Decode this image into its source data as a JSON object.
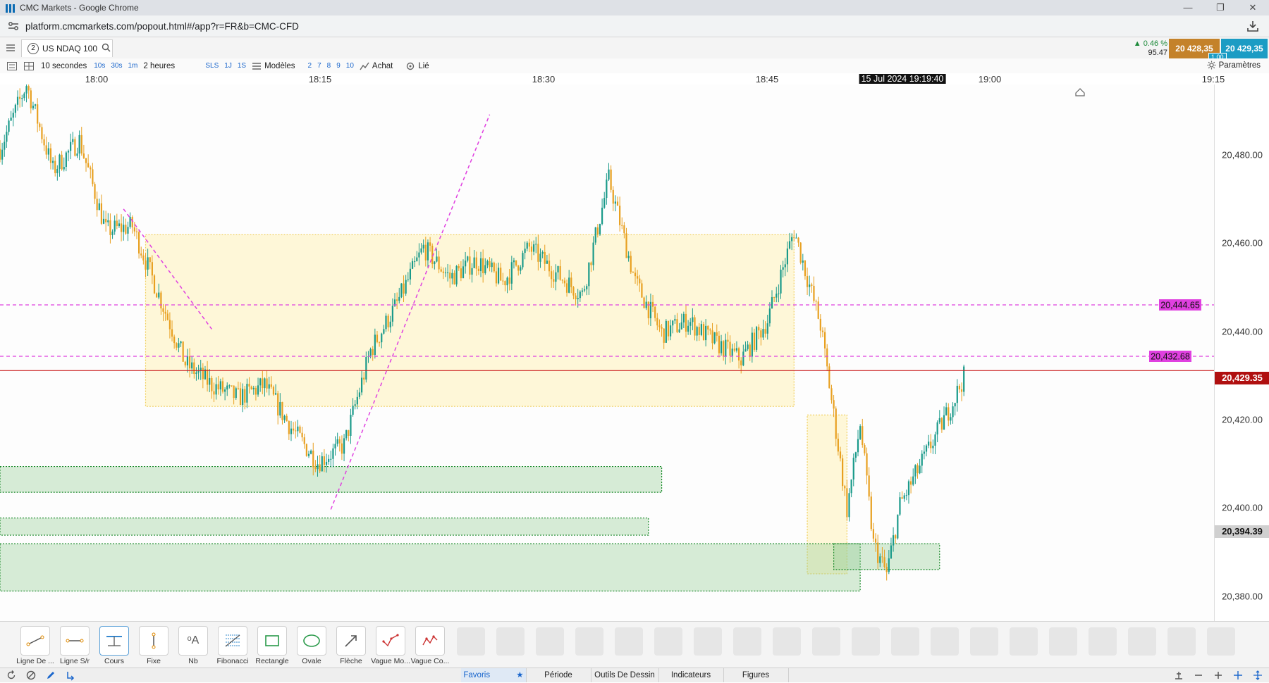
{
  "browser": {
    "window_title": "CMC Markets - Google Chrome",
    "url": "platform.cmcmarkets.com/popout.html#/app?r=FR&b=CMC-CFD"
  },
  "instrument": {
    "tab_number": "2",
    "name": "US NDAQ 100",
    "change_percent": "▲ 0.46 %",
    "change_points": "95.47",
    "sell_price": "20 428,35",
    "buy_price": "20 429,35",
    "spread": "1.00"
  },
  "toolbar": {
    "interval": "10 secondes",
    "quick_intervals": [
      "10s",
      "30s",
      "1m"
    ],
    "range": "2 heures",
    "quick_ranges": [
      "SLS",
      "1J",
      "1S"
    ],
    "templates": "Modèles",
    "template_slots": [
      "2",
      "7",
      "8",
      "9",
      "10"
    ],
    "buy_label": "Achat",
    "linked_label": "Lié",
    "settings_label": "Paramètres"
  },
  "time_axis": {
    "labels": [
      "18:00",
      "18:15",
      "18:30",
      "18:45",
      "19:00",
      "19:15"
    ],
    "cursor_label": "15 Jul 2024 19:19:40"
  },
  "price_axis": {
    "labels": [
      "20,480.00",
      "20,460.00",
      "20,440.00",
      "20,420.00",
      "20,400.00",
      "20,380.00"
    ],
    "current_price": "20,429.35",
    "hover_price": "20,394.39"
  },
  "chart_data": {
    "type": "candlestick",
    "instrument": "US NDAQ 100",
    "interval": "10 secondes",
    "y_range": [
      20371,
      20496
    ],
    "x_range": [
      "17:58",
      "19:19:40"
    ],
    "current_price": 20429.35,
    "horizontal_lines": [
      {
        "price": 20444.65,
        "label": "20,444.65",
        "color": "#e040e0",
        "style": "dashed"
      },
      {
        "price": 20432.68,
        "label": "20,432.68",
        "color": "#e040e0",
        "style": "dashed"
      },
      {
        "price": 20429.35,
        "color": "#cc2020",
        "style": "solid"
      }
    ],
    "trend_lines": [
      {
        "from": [
          "18:07:20",
          20467
        ],
        "to": [
          "18:14",
          20439
        ],
        "color": "#e040e0"
      },
      {
        "from": [
          "18:23",
          20397
        ],
        "to": [
          "18:35",
          20489
        ],
        "color": "#e040e0"
      }
    ],
    "rectangles": [
      {
        "from": [
          "18:09",
          20461
        ],
        "to": [
          "18:58",
          20421
        ],
        "fill": "yellow"
      },
      {
        "from": [
          "18:59",
          20419
        ],
        "to": [
          "19:02",
          20382
        ],
        "fill": "yellow"
      },
      {
        "from": [
          "17:58",
          20407
        ],
        "to": [
          "18:48",
          20401
        ],
        "fill": "green"
      },
      {
        "from": [
          "17:58",
          20395
        ],
        "to": [
          "18:47",
          20391
        ],
        "fill": "green"
      },
      {
        "from": [
          "17:58",
          20389
        ],
        "to": [
          "19:03",
          20378
        ],
        "fill": "green"
      },
      {
        "from": [
          "19:01",
          20389
        ],
        "to": [
          "19:09",
          20383
        ],
        "fill": "green"
      }
    ],
    "up_color": "#1a9a8a",
    "down_color": "#e8a020",
    "path": [
      [
        "17:58",
        20481
      ],
      [
        "18:00",
        20496
      ],
      [
        "18:02",
        20476
      ],
      [
        "18:04",
        20483
      ],
      [
        "18:06",
        20462
      ],
      [
        "18:08",
        20463
      ],
      [
        "18:10",
        20447
      ],
      [
        "18:12",
        20431
      ],
      [
        "18:14",
        20426
      ],
      [
        "18:16",
        20423
      ],
      [
        "18:18",
        20426
      ],
      [
        "18:20",
        20416
      ],
      [
        "18:22",
        20408
      ],
      [
        "18:24",
        20412
      ],
      [
        "18:26",
        20434
      ],
      [
        "18:28",
        20445
      ],
      [
        "18:30",
        20458
      ],
      [
        "18:32",
        20451
      ],
      [
        "18:34",
        20455
      ],
      [
        "18:36",
        20450
      ],
      [
        "18:38",
        20458
      ],
      [
        "18:40",
        20452
      ],
      [
        "18:42",
        20447
      ],
      [
        "18:44",
        20474
      ],
      [
        "18:46",
        20450
      ],
      [
        "18:48",
        20438
      ],
      [
        "18:50",
        20441
      ],
      [
        "18:52",
        20436
      ],
      [
        "18:54",
        20432
      ],
      [
        "18:56",
        20441
      ],
      [
        "18:58",
        20462
      ],
      [
        "19:00",
        20440
      ],
      [
        "19:01",
        20419
      ],
      [
        "19:02",
        20397
      ],
      [
        "19:03",
        20417
      ],
      [
        "19:04",
        20389
      ],
      [
        "19:05",
        20382
      ],
      [
        "19:06",
        20398
      ],
      [
        "19:08",
        20410
      ],
      [
        "19:10",
        20422
      ],
      [
        "19:11",
        20429
      ]
    ]
  },
  "drawing_tools": [
    {
      "label": "Ligne De ...",
      "icon": "line-icon"
    },
    {
      "label": "Ligne S/r",
      "icon": "sr-line-icon"
    },
    {
      "label": "Cours",
      "icon": "price-line-icon"
    },
    {
      "label": "Fixe",
      "icon": "fixed-line-icon"
    },
    {
      "label": "Nb",
      "icon": "text-icon"
    },
    {
      "label": "Fibonacci",
      "icon": "fibonacci-icon"
    },
    {
      "label": "Rectangle",
      "icon": "rectangle-icon"
    },
    {
      "label": "Ovale",
      "icon": "oval-icon"
    },
    {
      "label": "Flèche",
      "icon": "arrow-icon"
    },
    {
      "label": "Vague Mo...",
      "icon": "wave-icon"
    },
    {
      "label": "Vague Co...",
      "icon": "wave-corrective-icon"
    }
  ],
  "status_tabs": [
    "Favoris",
    "Période",
    "Outils De Dessin",
    "Indicateurs",
    "Figures"
  ]
}
